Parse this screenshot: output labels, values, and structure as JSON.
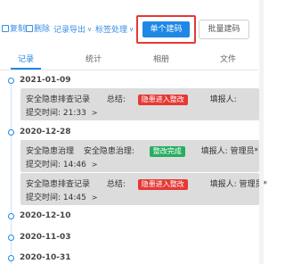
{
  "toolbar": {
    "copy": "复制",
    "delete": "删除",
    "export": "记录导出",
    "tag": "标签处理",
    "single_code": "单个建码",
    "batch_code": "批量建码"
  },
  "tabs": [
    {
      "label": "记录"
    },
    {
      "label": "统计"
    },
    {
      "label": "相册"
    },
    {
      "label": "文件"
    }
  ],
  "dates": [
    "2021-01-09",
    "2020-12-28",
    "2020-12-10",
    "2020-11-03",
    "2020-10-31"
  ],
  "records": [
    {
      "title": "安全隐患排查记录",
      "summary_label": "总结:",
      "badge": "隐患进入整改",
      "reporter_label": "填报人:",
      "reporter": "",
      "time_label": "提交时间:",
      "time": "21:33",
      "arrow": ">"
    },
    {
      "title": "安全隐患治理",
      "mid": "安全隐患治理:",
      "badge": "整改完成",
      "reporter_label": "填报人:",
      "reporter": "管理员*",
      "time_label": "提交时间:",
      "time": "14:46",
      "arrow": ">"
    },
    {
      "title": "安全隐患排查记录",
      "summary_label": "总结:",
      "badge": "隐患进入整改",
      "reporter_label": "填报人:",
      "reporter": "管理员*",
      "time_label": "提交时间:",
      "time": "14:45",
      "arrow": ">"
    }
  ],
  "colors": {
    "accent": "#1e88e5",
    "red": "#e53935",
    "green": "#27ae60"
  }
}
